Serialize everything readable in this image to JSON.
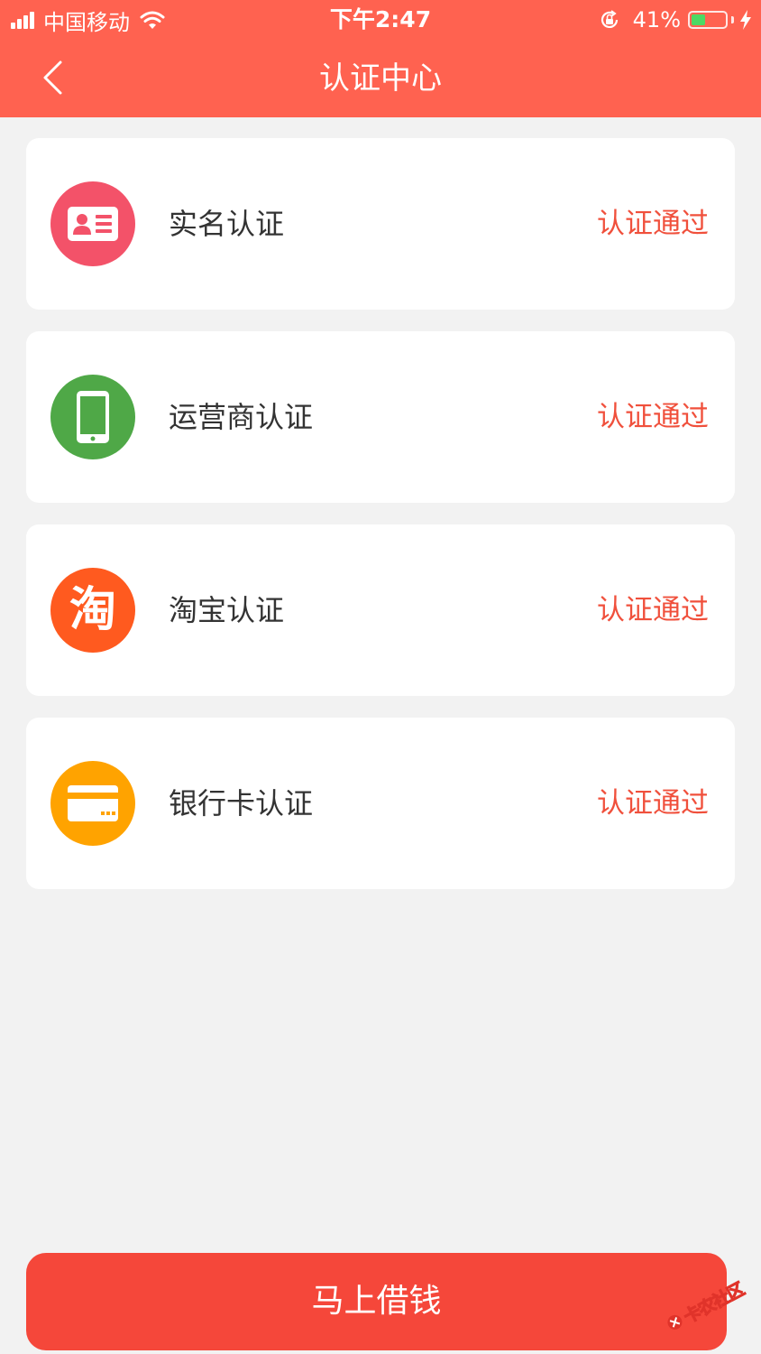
{
  "status_bar": {
    "carrier": "中国移动",
    "time": "下午2:47",
    "battery": "41%",
    "battery_level": 0.41
  },
  "nav": {
    "title": "认证中心",
    "back_icon": "chevron-left-icon"
  },
  "cards": [
    {
      "label": "实名认证",
      "status": "认证通过",
      "icon": "id-card-icon",
      "color": "#f35269"
    },
    {
      "label": "运营商认证",
      "status": "认证通过",
      "icon": "phone-icon",
      "color": "#4fa847"
    },
    {
      "label": "淘宝认证",
      "status": "认证通过",
      "icon": "taobao-icon",
      "icon_text": "淘",
      "color": "#ff5a1f"
    },
    {
      "label": "银行卡认证",
      "status": "认证通过",
      "icon": "bank-card-icon",
      "color": "#ffa300"
    }
  ],
  "colors": {
    "header": "#ff6250",
    "status_text": "#f0503c",
    "button": "#f5473a"
  },
  "loan_button": {
    "label": "马上借钱"
  },
  "watermark": {
    "text": "卡农社区"
  }
}
